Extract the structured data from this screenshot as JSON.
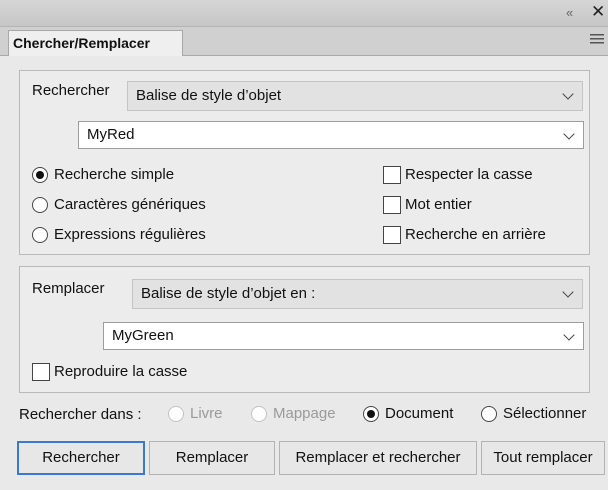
{
  "window": {
    "collapse_glyph": "«",
    "close_glyph": "✕"
  },
  "panel": {
    "tab_label": "Chercher/Remplacer"
  },
  "search": {
    "label": "Rechercher",
    "type_value": "Balise de style d’objet",
    "value": "MyRed"
  },
  "modes": [
    {
      "label": "Recherche simple",
      "checked": true
    },
    {
      "label": "Caractères génériques",
      "checked": false
    },
    {
      "label": "Expressions régulières",
      "checked": false
    }
  ],
  "checks": [
    {
      "label": "Respecter la casse",
      "checked": false
    },
    {
      "label": "Mot entier",
      "checked": false
    },
    {
      "label": "Recherche en arrière",
      "checked": false
    }
  ],
  "replace": {
    "label": "Remplacer",
    "type_value": "Balise de style d’objet en :",
    "value": "MyGreen",
    "preserve_case_label": "Reproduire la casse"
  },
  "scope": {
    "label": "Rechercher dans :",
    "options": [
      {
        "label": "Livre",
        "selected": false,
        "enabled": false
      },
      {
        "label": "Mappage",
        "selected": false,
        "enabled": false
      },
      {
        "label": "Document",
        "selected": true,
        "enabled": true
      },
      {
        "label": "Sélectionner",
        "selected": false,
        "enabled": true
      }
    ]
  },
  "buttons": {
    "find": "Rechercher",
    "replace": "Remplacer",
    "replace_find": "Remplacer et rechercher",
    "replace_all": "Tout remplacer"
  },
  "colors": {
    "accent": "#3b78d0",
    "panel_bg": "#e9e9e9"
  }
}
